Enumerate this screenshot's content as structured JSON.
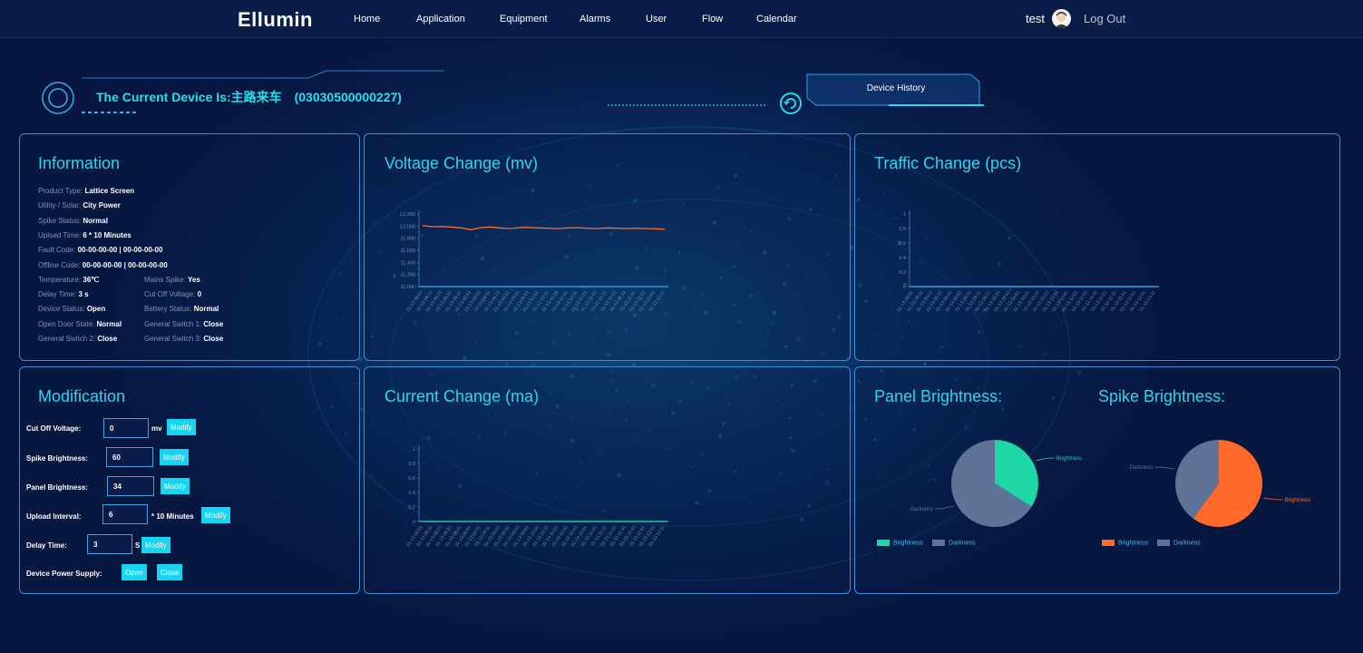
{
  "nav": {
    "logo": "Ellumin",
    "items": [
      "Home",
      "Application",
      "Equipment",
      "Alarms",
      "User",
      "Flow",
      "Calendar"
    ],
    "user": "test",
    "logout": "Log Out"
  },
  "device": {
    "title": "The Current Device Is:主路来车　(03030500000227)",
    "history_button": "Device History"
  },
  "information": {
    "title": "Information",
    "rows": [
      {
        "label": "Product Type:",
        "value": "Lattice Screen",
        "status": "normal"
      },
      {
        "label": "Utility / Solar:",
        "value": "City Power",
        "status": "normal"
      },
      {
        "label": "Spike Status:",
        "value": "Normal",
        "status": "ok"
      },
      {
        "label": "Upload Time:",
        "value": "6 * 10 Minutes",
        "status": "normal"
      },
      {
        "label": "Fault Code:",
        "value": "00-00-00-00 | 00-00-00-00",
        "status": "normal"
      },
      {
        "label": "Offline Code:",
        "value": "00-00-00-00 | 00-00-00-00",
        "status": "normal"
      }
    ],
    "pairs": [
      [
        {
          "label": "Temperature:",
          "value": "36℃",
          "status": "normal"
        },
        {
          "label": "Mains Spike:",
          "value": "Yes",
          "status": "normal"
        }
      ],
      [
        {
          "label": "Delay Time:",
          "value": "3 s",
          "status": "normal"
        },
        {
          "label": "Cut Off Voltage:",
          "value": "0",
          "status": "normal"
        }
      ],
      [
        {
          "label": "Device Status:",
          "value": "Open",
          "status": "ok"
        },
        {
          "label": "Battery Status:",
          "value": "Normal",
          "status": "ok"
        }
      ],
      [
        {
          "label": "Open Door State:",
          "value": "Normal",
          "status": "ok"
        },
        {
          "label": "General Switch 1:",
          "value": "Close",
          "status": "bad"
        }
      ],
      [
        {
          "label": "General Switch 2:",
          "value": "Close",
          "status": "bad"
        },
        {
          "label": "General Switch 3:",
          "value": "Close",
          "status": "bad"
        }
      ]
    ]
  },
  "modification": {
    "title": "Modification",
    "cut_off": {
      "label": "Cut Off Voltage:",
      "value": "0",
      "unit": "mv",
      "button": "Modify"
    },
    "spike": {
      "label": "Spike Brightness:",
      "value": "60",
      "button": "Modify"
    },
    "panel": {
      "label": "Panel Brightness:",
      "value": "34",
      "button": "Modify"
    },
    "upload": {
      "label": "Upload Interval:",
      "value": "6",
      "unit": "* 10 Minutes",
      "button": "Modify"
    },
    "delay": {
      "label": "Delay Time:",
      "value": "3",
      "unit": "S",
      "button": "Modify"
    },
    "power": {
      "label": "Device Power Supply:",
      "open": "Open",
      "close": "Close"
    }
  },
  "colors": {
    "accent": "#2fd5ec",
    "button": "#18d4f3",
    "ok": "#2ee84e",
    "bad": "#ff3a3a",
    "brightness_panel": "#1fd6a5",
    "brightness_spike": "#ff6a2a",
    "darkness": "#5f7399",
    "voltage_line": "#ff6a2a",
    "current_line": "#1fd6a5"
  },
  "chart_data": [
    {
      "id": "voltage",
      "type": "line",
      "title": "Voltage Change (mv)",
      "ylim": [
        11000,
        12200
      ],
      "yticks": [
        "11,000",
        "11,200",
        "11,400",
        "11,600",
        "11,800",
        "12,000",
        "12,200"
      ],
      "x": [
        "01-13 08:01",
        "01-13 08:11",
        "01-13 08:21",
        "01-13 08:31",
        "01-13 08:41",
        "01-13 08:51",
        "01-13 09:01",
        "01-13 09:11",
        "01-13 09:21",
        "01-13 09:31",
        "01-13 09:41",
        "01-13 09:51",
        "01-13 10:01",
        "01-13 10:11",
        "01-13 10:21",
        "01-13 10:31",
        "01-13 10:41",
        "01-13 10:51",
        "01-13 11:01",
        "01-13 11:11",
        "01-13 11:21",
        "01-13 11:31",
        "01-13 11:41",
        "01-13 11:51",
        "01-13 12:01",
        "01-13 12:11"
      ],
      "values": [
        12010,
        11990,
        11995,
        11985,
        11970,
        11940,
        11975,
        11985,
        11970,
        11960,
        11975,
        11980,
        11970,
        11965,
        11960,
        11970,
        11975,
        11965,
        11960,
        11970,
        11965,
        11960,
        11965,
        11960,
        11955,
        11950
      ]
    },
    {
      "id": "traffic",
      "type": "line",
      "title": "Traffic Change (pcs)",
      "ylim": [
        0,
        1
      ],
      "yticks": [
        "0",
        "0.2",
        "0.4",
        "0.6",
        "0.8",
        "1"
      ],
      "x": [
        "01-13 08:01",
        "01-13 08:11",
        "01-13 08:21",
        "01-13 08:31",
        "01-13 08:41",
        "01-13 08:51",
        "01-13 09:01",
        "01-13 09:11",
        "01-13 09:21",
        "01-13 09:31",
        "01-13 09:41",
        "01-13 09:51",
        "01-13 10:01",
        "01-13 10:11",
        "01-13 10:21",
        "01-13 10:31",
        "01-13 10:41",
        "01-13 10:51",
        "01-13 11:01",
        "01-13 11:11",
        "01-13 11:21",
        "01-13 11:31",
        "01-13 11:41",
        "01-13 11:51",
        "01-13 12:01",
        "01-13 12:11"
      ],
      "values": [
        0,
        0,
        0,
        0,
        0,
        0,
        0,
        0,
        0,
        0,
        0,
        0,
        0,
        0,
        0,
        0,
        0,
        0,
        0,
        0,
        0,
        0,
        0,
        0,
        0,
        0
      ]
    },
    {
      "id": "current",
      "type": "line",
      "title": "Current Change (ma)",
      "ylim": [
        0,
        1
      ],
      "yticks": [
        "0",
        "0.2",
        "0.4",
        "0.6",
        "0.8",
        "1"
      ],
      "x": [
        "01-13 08:01",
        "01-13 08:11",
        "01-13 08:21",
        "01-13 08:31",
        "01-13 08:41",
        "01-13 08:51",
        "01-13 09:01",
        "01-13 09:11",
        "01-13 09:21",
        "01-13 09:31",
        "01-13 09:41",
        "01-13 09:51",
        "01-13 10:01",
        "01-13 10:11",
        "01-13 10:21",
        "01-13 10:31",
        "01-13 10:41",
        "01-13 10:51",
        "01-13 11:01",
        "01-13 11:11",
        "01-13 11:21",
        "01-13 11:31",
        "01-13 11:41",
        "01-13 11:51",
        "01-13 12:01",
        "01-13 12:11"
      ],
      "values": [
        0,
        0,
        0,
        0,
        0,
        0,
        0,
        0,
        0,
        0,
        0,
        0,
        0,
        0,
        0,
        0,
        0,
        0,
        0,
        0,
        0,
        0,
        0,
        0,
        0,
        0
      ]
    },
    {
      "id": "panel_brightness",
      "type": "pie",
      "title": "Panel Brightness:",
      "slices": [
        {
          "name": "Brightness",
          "value": 34
        },
        {
          "name": "Darkness",
          "value": 66
        }
      ],
      "legend": [
        "Brightness",
        "Darkness"
      ]
    },
    {
      "id": "spike_brightness",
      "type": "pie",
      "title": "Spike Brightness:",
      "slices": [
        {
          "name": "Brightness",
          "value": 60
        },
        {
          "name": "Darkness",
          "value": 40
        }
      ],
      "legend": [
        "Brightness",
        "Darkness"
      ]
    }
  ]
}
